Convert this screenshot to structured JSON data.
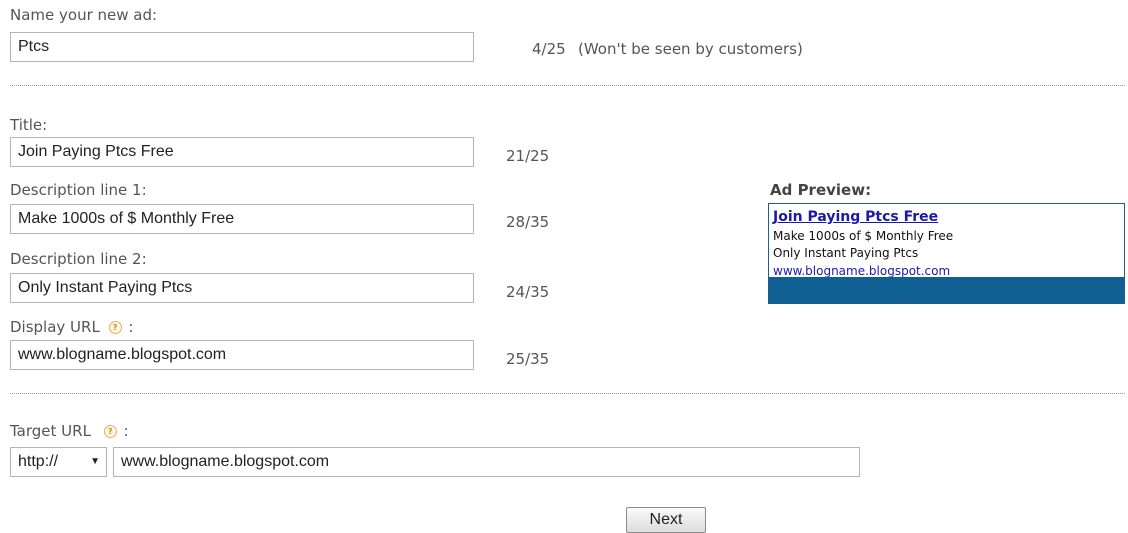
{
  "ad_name": {
    "label": "Name your new ad:",
    "value": "Ptcs",
    "counter": "4/25",
    "note": "(Won't be seen by customers)"
  },
  "title": {
    "label": "Title:",
    "value": "Join Paying Ptcs Free",
    "counter": "21/25"
  },
  "desc1": {
    "label": "Description line 1:",
    "value": "Make 1000s of $ Monthly Free",
    "counter": "28/35"
  },
  "desc2": {
    "label": "Description line 2:",
    "value": "Only Instant Paying Ptcs",
    "counter": "24/35"
  },
  "display_url": {
    "label": "Display URL",
    "colon": ":",
    "value": "www.blogname.blogspot.com",
    "counter": "25/35"
  },
  "preview": {
    "heading": "Ad Preview:",
    "title": "Join Paying Ptcs Free",
    "line1": "Make 1000s of $ Monthly Free",
    "line2": "Only Instant Paying Ptcs",
    "url": "www.blogname.blogspot.com"
  },
  "target_url": {
    "label": "Target URL",
    "colon": ":",
    "protocol": "http://",
    "value": "www.blogname.blogspot.com"
  },
  "help_glyph": "?",
  "next_label": "Next",
  "icons": {
    "help": "help-icon",
    "dropdown": "chevron-down-icon"
  },
  "colors": {
    "preview_border": "#1e5f8f",
    "preview_band": "#0f5f92",
    "link": "#1a1aa6"
  }
}
